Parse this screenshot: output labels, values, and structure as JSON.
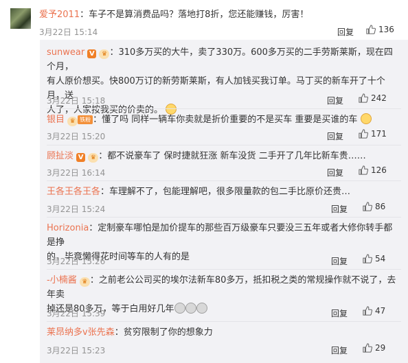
{
  "top_comment": {
    "user": "爱予2011",
    "text": "：车子不是算消费品吗？落地打8折，您还能赚钱，厉害！",
    "time": "3月22日 15:14",
    "reply": "回复",
    "likes": "136"
  },
  "replies": [
    {
      "user": "sunwear",
      "badges": [
        "v",
        "lvl",
        "lvl"
      ],
      "line1": "：310多万买的大牛，卖了330万。600多万买的二手劳斯莱斯，现在四个月，",
      "line2": "有人原价想买。快800万订的新劳斯莱斯，有人加钱买我订单。马丁买的新车开了十个月，送",
      "line3": "人了，人家按我买的价卖的。",
      "emoji": 1,
      "time": "3月22日 15:18",
      "reply": "回复",
      "likes": "242"
    },
    {
      "user": "银目",
      "badges": [
        "lvl",
        "fan"
      ],
      "fan_label": "铁粉",
      "line1": "：懂了吗 同样一辆车你卖就是折价重要的不是买车 重要是买谁的车",
      "emoji": 1,
      "time": "3月22日 15:20",
      "reply": "回复",
      "likes": "171"
    },
    {
      "user": "顾扯淡",
      "badges": [
        "v",
        "lvl"
      ],
      "line1": "：都不说豪车了 保时捷就狂涨 新车没货 二手开了几年比新车贵……",
      "time": "3月22日 16:14",
      "reply": "回复",
      "likes": "126"
    },
    {
      "user": "王各王各王各",
      "line1": "：车理解不了，包能理解吧，很多限量款的包二手比原价还贵…",
      "time": "3月22日 15:24",
      "reply": "回复",
      "likes": "86"
    },
    {
      "user": "Horizonia",
      "line1": "：定制豪车哪怕是加价提车的那些百万级豪车只要没三五年或者大修你转手都是挣",
      "line2": "的，毕竟懒得花时间等车的人有的是",
      "time": "3月22日 15:26",
      "reply": "回复",
      "likes": "54"
    },
    {
      "user": "-小楠酱",
      "badges": [
        "lvl"
      ],
      "line1": "：之前老公公司买的埃尔法新车80多万，抵扣税之类的常规操作就不说了，去年卖",
      "line2": "掉还是80多万，等于白用好几年",
      "emoji": 3,
      "time": "3月22日 15:39",
      "reply": "回复",
      "likes": "47"
    },
    {
      "user": "莱昂纳多v张先森",
      "line1": "：贫穷限制了你的想象力",
      "time": "3月22日 15:23",
      "reply": "回复",
      "likes": "29"
    }
  ],
  "icons": {
    "like": "thumb-up-icon",
    "verified": "v-badge-icon",
    "level": "member-level-icon"
  },
  "colors": {
    "username": "#eb7350",
    "time": "#939393",
    "panel_bg": "#f2f2f5"
  }
}
